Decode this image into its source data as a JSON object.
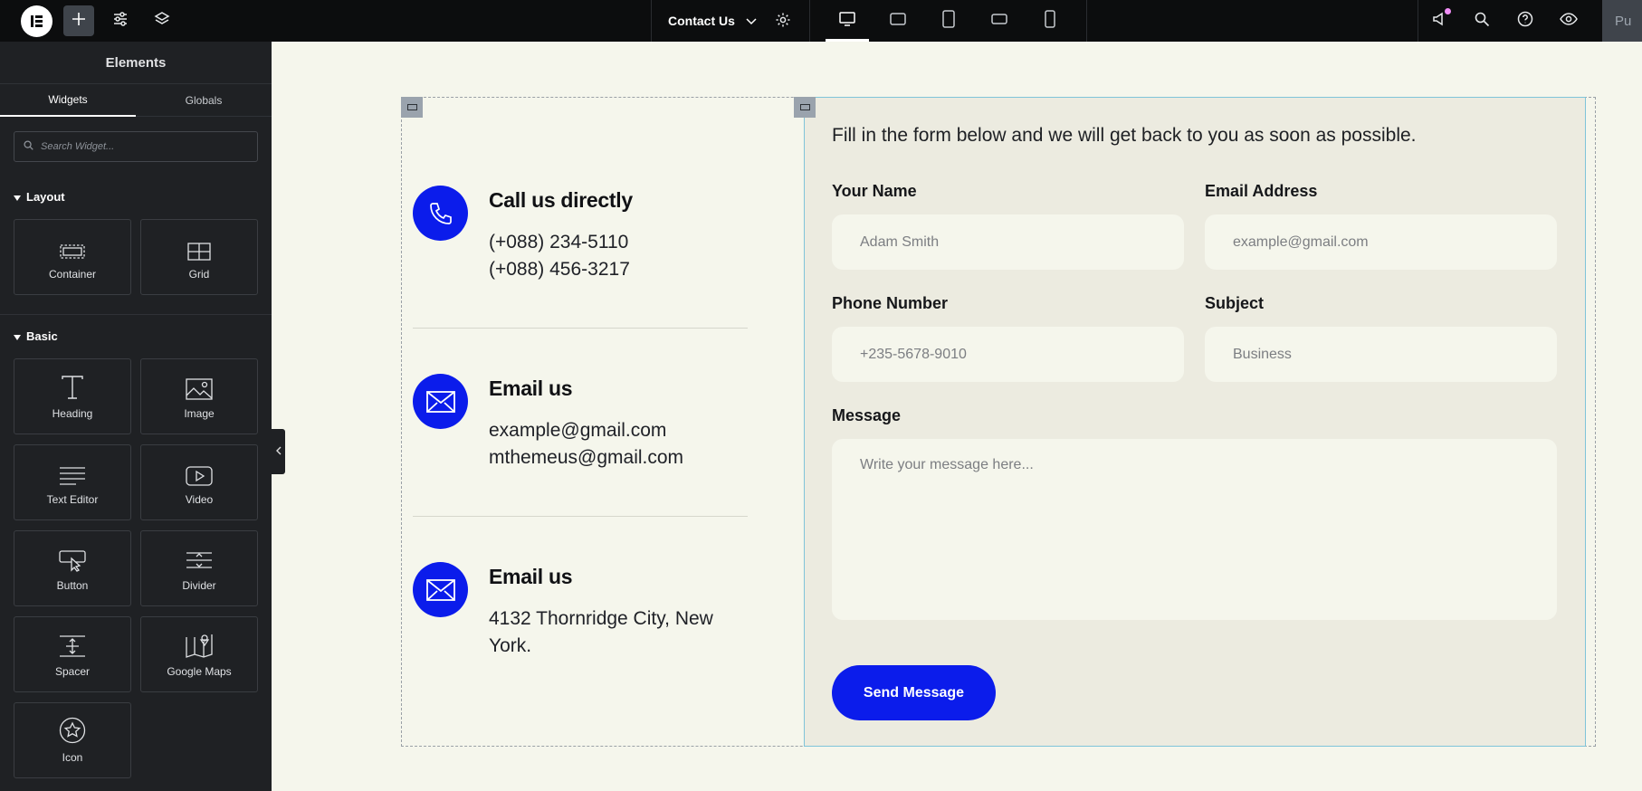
{
  "topbar": {
    "page_name": "Contact Us",
    "publish_label": "Pu",
    "notification_color": "#f08df5"
  },
  "panel": {
    "title": "Elements",
    "tabs": [
      {
        "label": "Widgets",
        "active": true
      },
      {
        "label": "Globals",
        "active": false
      }
    ],
    "search_placeholder": "Search Widget...",
    "categories": [
      {
        "label": "Layout",
        "widgets": [
          {
            "label": "Container",
            "icon": "container-icon"
          },
          {
            "label": "Grid",
            "icon": "grid-icon"
          }
        ]
      },
      {
        "label": "Basic",
        "widgets": [
          {
            "label": "Heading",
            "icon": "heading-icon"
          },
          {
            "label": "Image",
            "icon": "image-icon"
          },
          {
            "label": "Text Editor",
            "icon": "text-editor-icon"
          },
          {
            "label": "Video",
            "icon": "video-icon"
          },
          {
            "label": "Button",
            "icon": "button-icon"
          },
          {
            "label": "Divider",
            "icon": "divider-icon"
          },
          {
            "label": "Spacer",
            "icon": "spacer-icon"
          },
          {
            "label": "Google Maps",
            "icon": "google-maps-icon"
          },
          {
            "label": "Icon",
            "icon": "star-icon"
          }
        ]
      }
    ]
  },
  "contact_info": [
    {
      "title": "Call us directly",
      "lines": [
        "(+088) 234-5110",
        "(+088) 456-3217"
      ],
      "icon": "phone-icon"
    },
    {
      "title": "Email us",
      "lines": [
        "example@gmail.com",
        "mthemeus@gmail.com"
      ],
      "icon": "envelope-icon"
    },
    {
      "title": "Email us",
      "lines": [
        "4132 Thornridge City, New York."
      ],
      "icon": "envelope-icon"
    }
  ],
  "form": {
    "intro": "Fill in the form below and we will get back to you as soon as possible.",
    "name_label": "Your Name",
    "name_placeholder": "Adam Smith",
    "email_label": "Email Address",
    "email_placeholder": "example@gmail.com",
    "phone_label": "Phone Number",
    "phone_placeholder": "+235-5678-9010",
    "subject_label": "Subject",
    "subject_placeholder": "Business",
    "message_label": "Message",
    "message_placeholder": "Write your message here...",
    "submit_label": "Send Message"
  },
  "colors": {
    "accent": "#0b1ceb",
    "canvas_bg": "#f5f6ec",
    "form_bg": "#ecebe0",
    "panel_bg": "#1f2124",
    "topbar_bg": "#0c0d0e"
  }
}
